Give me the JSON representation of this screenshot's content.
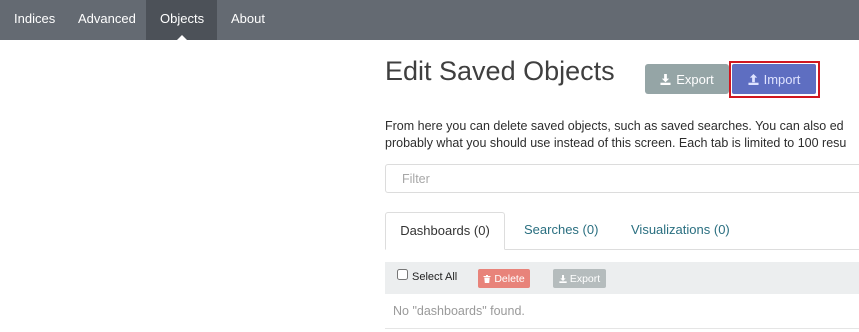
{
  "nav": {
    "items": [
      {
        "label": "Indices"
      },
      {
        "label": "Advanced"
      },
      {
        "label": "Objects",
        "active": true
      },
      {
        "label": "About"
      }
    ]
  },
  "header": {
    "title": "Edit Saved Objects",
    "export_label": "Export",
    "import_label": "Import"
  },
  "description": {
    "line1": "From here you can delete saved objects, such as saved searches. You can also ed",
    "line2": "probably what you should use instead of this screen. Each tab is limited to 100 resu"
  },
  "filter": {
    "placeholder": "Filter",
    "value": ""
  },
  "tabs": [
    {
      "label": "Dashboards (0)",
      "active": true
    },
    {
      "label": "Searches (0)"
    },
    {
      "label": "Visualizations (0)"
    }
  ],
  "toolbar": {
    "select_all_label": "Select All",
    "delete_label": "Delete",
    "export_label": "Export"
  },
  "table": {
    "empty_message": "No \"dashboards\" found."
  },
  "colors": {
    "nav_bg": "#646a72",
    "nav_active_bg": "#4c5158",
    "export_button": "#95a5a6",
    "import_button": "#5e6ec1",
    "highlight_border": "#d0161f",
    "delete_button": "#e8837a",
    "tab_link": "#2a6f80"
  },
  "icons": {
    "export": "download-icon",
    "import": "upload-icon",
    "delete": "trash-icon"
  }
}
